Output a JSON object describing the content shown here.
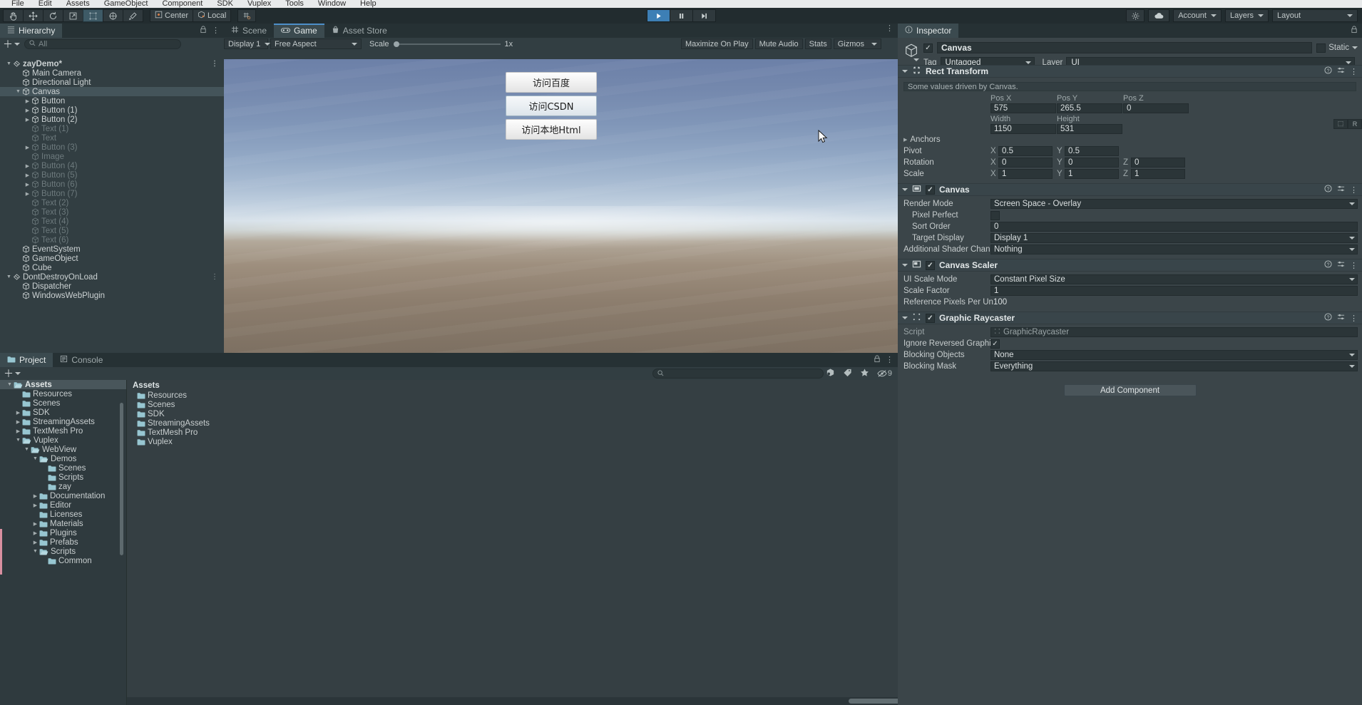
{
  "menu": {
    "items": [
      "File",
      "Edit",
      "Assets",
      "GameObject",
      "Component",
      "SDK",
      "Vuplex",
      "Tools",
      "Window",
      "Help"
    ]
  },
  "toolbar": {
    "tools": [
      "hand-tool",
      "move-tool",
      "rotate-tool",
      "scale-tool",
      "rect-tool",
      "transform-tool",
      "custom-tool"
    ],
    "pivot_label": "Center",
    "space_label": "Local",
    "grid_label": "grid-snap",
    "play_label": "play",
    "pause_label": "pause",
    "step_label": "step",
    "cloud_label": "cloud",
    "services_label": "services",
    "account_label": "Account",
    "layers_label": "Layers",
    "layout_label": "Layout"
  },
  "hierarchy": {
    "tab_label": "Hierarchy",
    "search_placeholder": "All",
    "add_label": "+",
    "items": [
      {
        "label": "zayDemo*",
        "depth": 0,
        "icon": "scene-icon",
        "arrow": "down",
        "dim": false,
        "bold": true,
        "selected": false,
        "dots": true
      },
      {
        "label": "Main Camera",
        "depth": 1,
        "icon": "gameobject-icon",
        "arrow": "none",
        "dim": false,
        "bold": false,
        "selected": false,
        "dots": false
      },
      {
        "label": "Directional Light",
        "depth": 1,
        "icon": "gameobject-icon",
        "arrow": "none",
        "dim": false,
        "bold": false,
        "selected": false,
        "dots": false
      },
      {
        "label": "Canvas",
        "depth": 1,
        "icon": "gameobject-icon",
        "arrow": "down",
        "dim": false,
        "bold": false,
        "selected": true,
        "dots": false
      },
      {
        "label": "Button",
        "depth": 2,
        "icon": "gameobject-icon",
        "arrow": "right",
        "dim": false,
        "bold": false,
        "selected": false,
        "dots": false
      },
      {
        "label": "Button (1)",
        "depth": 2,
        "icon": "gameobject-icon",
        "arrow": "right",
        "dim": false,
        "bold": false,
        "selected": false,
        "dots": false
      },
      {
        "label": "Button (2)",
        "depth": 2,
        "icon": "gameobject-icon",
        "arrow": "right",
        "dim": false,
        "bold": false,
        "selected": false,
        "dots": false
      },
      {
        "label": "Text (1)",
        "depth": 2,
        "icon": "gameobject-icon",
        "arrow": "none",
        "dim": true,
        "bold": false,
        "selected": false,
        "dots": false
      },
      {
        "label": "Text",
        "depth": 2,
        "icon": "gameobject-icon",
        "arrow": "none",
        "dim": true,
        "bold": false,
        "selected": false,
        "dots": false
      },
      {
        "label": "Button (3)",
        "depth": 2,
        "icon": "gameobject-icon",
        "arrow": "right",
        "dim": true,
        "bold": false,
        "selected": false,
        "dots": false
      },
      {
        "label": "Image",
        "depth": 2,
        "icon": "gameobject-icon",
        "arrow": "none",
        "dim": true,
        "bold": false,
        "selected": false,
        "dots": false
      },
      {
        "label": "Button (4)",
        "depth": 2,
        "icon": "gameobject-icon",
        "arrow": "right",
        "dim": true,
        "bold": false,
        "selected": false,
        "dots": false
      },
      {
        "label": "Button (5)",
        "depth": 2,
        "icon": "gameobject-icon",
        "arrow": "right",
        "dim": true,
        "bold": false,
        "selected": false,
        "dots": false
      },
      {
        "label": "Button (6)",
        "depth": 2,
        "icon": "gameobject-icon",
        "arrow": "right",
        "dim": true,
        "bold": false,
        "selected": false,
        "dots": false
      },
      {
        "label": "Button (7)",
        "depth": 2,
        "icon": "gameobject-icon",
        "arrow": "right",
        "dim": true,
        "bold": false,
        "selected": false,
        "dots": false
      },
      {
        "label": "Text (2)",
        "depth": 2,
        "icon": "gameobject-icon",
        "arrow": "none",
        "dim": true,
        "bold": false,
        "selected": false,
        "dots": false
      },
      {
        "label": "Text (3)",
        "depth": 2,
        "icon": "gameobject-icon",
        "arrow": "none",
        "dim": true,
        "bold": false,
        "selected": false,
        "dots": false
      },
      {
        "label": "Text (4)",
        "depth": 2,
        "icon": "gameobject-icon",
        "arrow": "none",
        "dim": true,
        "bold": false,
        "selected": false,
        "dots": false
      },
      {
        "label": "Text (5)",
        "depth": 2,
        "icon": "gameobject-icon",
        "arrow": "none",
        "dim": true,
        "bold": false,
        "selected": false,
        "dots": false
      },
      {
        "label": "Text (6)",
        "depth": 2,
        "icon": "gameobject-icon",
        "arrow": "none",
        "dim": true,
        "bold": false,
        "selected": false,
        "dots": false
      },
      {
        "label": "EventSystem",
        "depth": 1,
        "icon": "gameobject-icon",
        "arrow": "none",
        "dim": false,
        "bold": false,
        "selected": false,
        "dots": false
      },
      {
        "label": "GameObject",
        "depth": 1,
        "icon": "gameobject-icon",
        "arrow": "none",
        "dim": false,
        "bold": false,
        "selected": false,
        "dots": false
      },
      {
        "label": "Cube",
        "depth": 1,
        "icon": "gameobject-icon",
        "arrow": "none",
        "dim": false,
        "bold": false,
        "selected": false,
        "dots": false
      },
      {
        "label": "DontDestroyOnLoad",
        "depth": 0,
        "icon": "scene-icon",
        "arrow": "down",
        "dim": false,
        "bold": false,
        "selected": false,
        "dots": true
      },
      {
        "label": "Dispatcher",
        "depth": 1,
        "icon": "gameobject-icon",
        "arrow": "none",
        "dim": false,
        "bold": false,
        "selected": false,
        "dots": false
      },
      {
        "label": "WindowsWebPlugin",
        "depth": 1,
        "icon": "gameobject-icon",
        "arrow": "none",
        "dim": false,
        "bold": false,
        "selected": false,
        "dots": false
      }
    ]
  },
  "gameview": {
    "tabs": [
      {
        "label": "Scene",
        "icon": "scene-grid-icon",
        "active": false
      },
      {
        "label": "Game",
        "icon": "gamepad-icon",
        "active": true
      },
      {
        "label": "Asset Store",
        "icon": "store-icon",
        "active": false
      }
    ],
    "display_label": "Display 1",
    "aspect_label": "Free Aspect",
    "scale_label": "Scale",
    "scale_value": "1x",
    "maximize_label": "Maximize On Play",
    "mute_label": "Mute Audio",
    "stats_label": "Stats",
    "gizmos_label": "Gizmos",
    "buttons": [
      {
        "label": "访问百度",
        "hover": false
      },
      {
        "label": "访问CSDN",
        "hover": true
      },
      {
        "label": "访问本地Html",
        "hover": false
      }
    ]
  },
  "inspector": {
    "tab_label": "Inspector",
    "object_name": "Canvas",
    "enabled": true,
    "static_label": "Static",
    "tag_label": "Tag",
    "tag_value": "Untagged",
    "layer_label": "Layer",
    "layer_value": "UI",
    "components": [
      {
        "name": "Rect Transform",
        "icon": "rect-transform-icon",
        "has_checkbox": false,
        "checked": false,
        "note": "Some values driven by Canvas.",
        "rows": [
          {
            "type": "triplet",
            "caps": [
              "Pos X",
              "Pos Y",
              "Pos Z"
            ],
            "vals": [
              "575",
              "265.5",
              "0"
            ]
          },
          {
            "type": "triplet",
            "caps": [
              "Width",
              "Height",
              ""
            ],
            "vals": [
              "1150",
              "531",
              ""
            ],
            "has_blueprint": true
          },
          {
            "type": "foldout",
            "label": "Anchors"
          },
          {
            "type": "axis2",
            "label": "Pivot",
            "axes": [
              "X",
              "Y"
            ],
            "vals": [
              "0.5",
              "0.5"
            ]
          },
          {
            "type": "axis3",
            "label": "Rotation",
            "axes": [
              "X",
              "Y",
              "Z"
            ],
            "vals": [
              "0",
              "0",
              "0"
            ]
          },
          {
            "type": "axis3",
            "label": "Scale",
            "axes": [
              "X",
              "Y",
              "Z"
            ],
            "vals": [
              "1",
              "1",
              "1"
            ]
          }
        ]
      },
      {
        "name": "Canvas",
        "icon": "canvas-icon",
        "has_checkbox": true,
        "checked": true,
        "rows": [
          {
            "type": "dropdown",
            "label": "Render Mode",
            "value": "Screen Space - Overlay"
          },
          {
            "type": "checkbox",
            "label": "Pixel Perfect",
            "indent": true,
            "checked": false
          },
          {
            "type": "text",
            "label": "Sort Order",
            "indent": true,
            "value": "0"
          },
          {
            "type": "dropdown",
            "label": "Target Display",
            "indent": true,
            "value": "Display 1"
          },
          {
            "type": "dropdown",
            "label": "Additional Shader Chan",
            "value": "Nothing"
          }
        ]
      },
      {
        "name": "Canvas Scaler",
        "icon": "canvas-scaler-icon",
        "has_checkbox": true,
        "checked": true,
        "rows": [
          {
            "type": "dropdown",
            "label": "UI Scale Mode",
            "value": "Constant Pixel Size"
          },
          {
            "type": "text",
            "label": "Scale Factor",
            "value": "1"
          },
          {
            "type": "plain",
            "label": "Reference Pixels Per Un",
            "value": "100"
          }
        ]
      },
      {
        "name": "Graphic Raycaster",
        "icon": "raycaster-icon",
        "has_checkbox": true,
        "checked": true,
        "rows": [
          {
            "type": "object",
            "label": "Script",
            "value": "GraphicRaycaster",
            "dim": true
          },
          {
            "type": "checkbox",
            "label": "Ignore Reversed Graphic",
            "checked": true
          },
          {
            "type": "dropdown",
            "label": "Blocking Objects",
            "value": "None"
          },
          {
            "type": "dropdown",
            "label": "Blocking Mask",
            "value": "Everything"
          }
        ]
      }
    ],
    "add_component_label": "Add Component"
  },
  "project": {
    "tabs": [
      {
        "label": "Project",
        "icon": "folder-icon",
        "active": true
      },
      {
        "label": "Console",
        "icon": "console-icon",
        "active": false
      }
    ],
    "add_label": "+",
    "search_placeholder": "",
    "filter_icons": [
      "asset-filter-icon",
      "label-filter-icon",
      "favorite-star-icon",
      "hidden-icon"
    ],
    "hidden_count": "9",
    "tree": [
      {
        "label": "Assets",
        "depth": 0,
        "arrow": "down",
        "open": true,
        "selected": true
      },
      {
        "label": "Resources",
        "depth": 1,
        "arrow": "none",
        "open": false,
        "selected": false
      },
      {
        "label": "Scenes",
        "depth": 1,
        "arrow": "none",
        "open": false,
        "selected": false
      },
      {
        "label": "SDK",
        "depth": 1,
        "arrow": "right",
        "open": false,
        "selected": false
      },
      {
        "label": "StreamingAssets",
        "depth": 1,
        "arrow": "right",
        "open": false,
        "selected": false
      },
      {
        "label": "TextMesh Pro",
        "depth": 1,
        "arrow": "right",
        "open": false,
        "selected": false
      },
      {
        "label": "Vuplex",
        "depth": 1,
        "arrow": "down",
        "open": true,
        "selected": false
      },
      {
        "label": "WebView",
        "depth": 2,
        "arrow": "down",
        "open": true,
        "selected": false
      },
      {
        "label": "Demos",
        "depth": 3,
        "arrow": "down",
        "open": true,
        "selected": false
      },
      {
        "label": "Scenes",
        "depth": 4,
        "arrow": "none",
        "open": false,
        "selected": false
      },
      {
        "label": "Scripts",
        "depth": 4,
        "arrow": "none",
        "open": false,
        "selected": false
      },
      {
        "label": "zay",
        "depth": 4,
        "arrow": "none",
        "open": false,
        "selected": false
      },
      {
        "label": "Documentation",
        "depth": 3,
        "arrow": "right",
        "open": false,
        "selected": false
      },
      {
        "label": "Editor",
        "depth": 3,
        "arrow": "right",
        "open": false,
        "selected": false
      },
      {
        "label": "Licenses",
        "depth": 3,
        "arrow": "none",
        "open": false,
        "selected": false
      },
      {
        "label": "Materials",
        "depth": 3,
        "arrow": "right",
        "open": false,
        "selected": false
      },
      {
        "label": "Plugins",
        "depth": 3,
        "arrow": "right",
        "open": false,
        "selected": false
      },
      {
        "label": "Prefabs",
        "depth": 3,
        "arrow": "right",
        "open": false,
        "selected": false
      },
      {
        "label": "Scripts",
        "depth": 3,
        "arrow": "down",
        "open": true,
        "selected": false
      },
      {
        "label": "Common",
        "depth": 4,
        "arrow": "none",
        "open": false,
        "selected": false
      }
    ],
    "content_header": "Assets",
    "content_items": [
      {
        "label": "Resources"
      },
      {
        "label": "Scenes"
      },
      {
        "label": "SDK"
      },
      {
        "label": "StreamingAssets"
      },
      {
        "label": "TextMesh Pro"
      },
      {
        "label": "Vuplex"
      }
    ]
  },
  "colors": {
    "panel_bg": "#323e42",
    "panel_dark": "#26302f",
    "inspector_bg": "#3b4549",
    "selection": "#44545a",
    "accent_blue": "#4d8fc9",
    "play_blue": "#3d7fb5",
    "text": "#c4c9ca",
    "text_dim": "#6d7a7d"
  }
}
